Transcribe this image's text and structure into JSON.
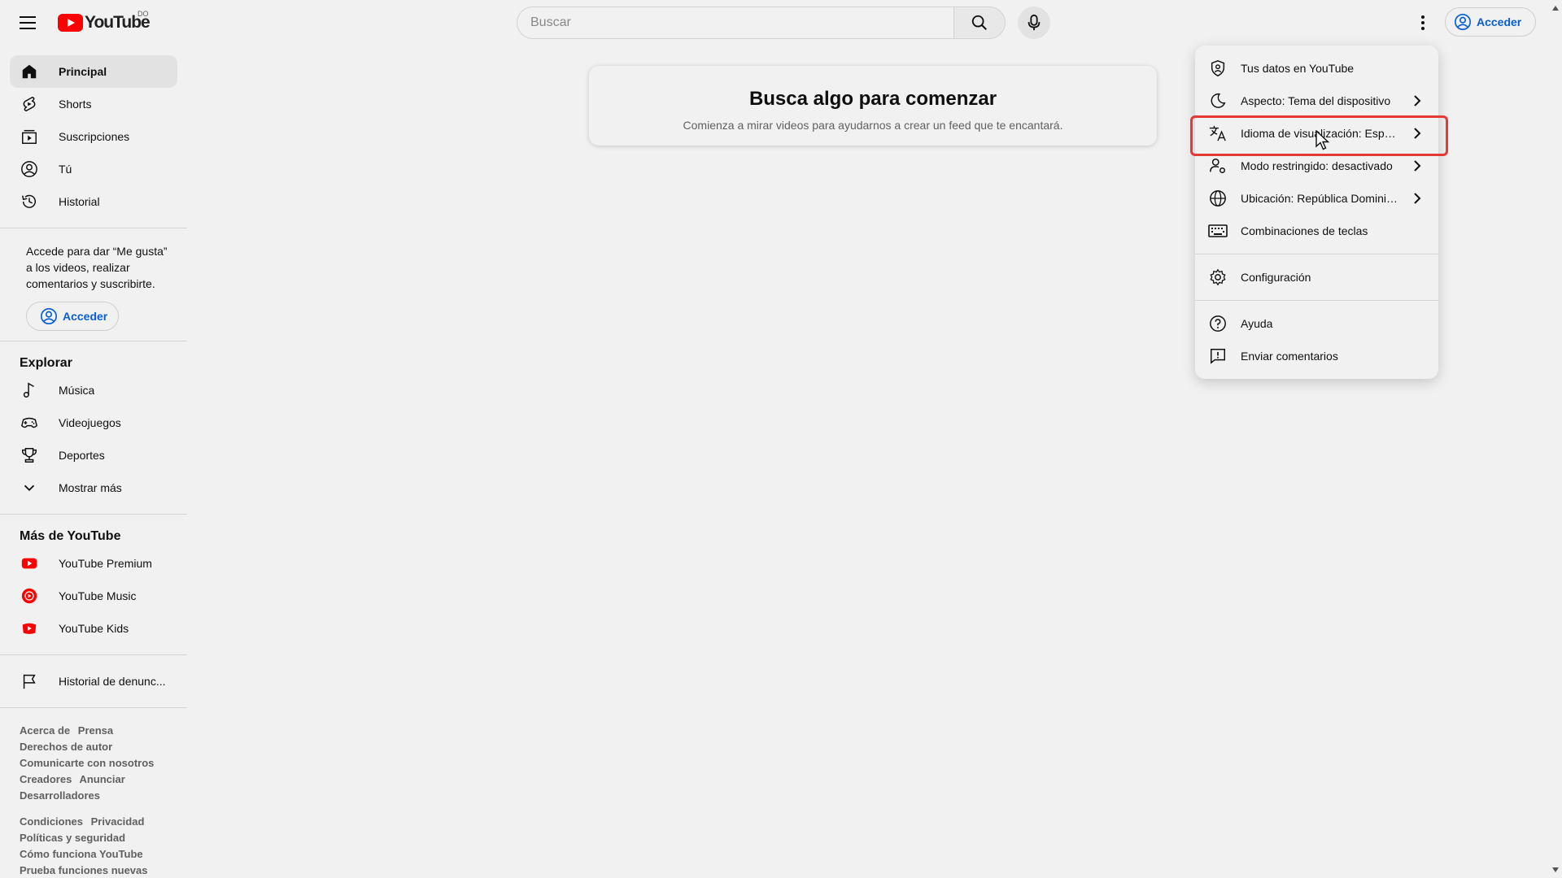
{
  "header": {
    "logo_text": "YouTube",
    "country_code": "DO",
    "search_placeholder": "Buscar",
    "signin_label": "Acceder"
  },
  "sidebar": {
    "main_items": [
      {
        "label": "Principal",
        "icon": "home-icon",
        "active": true
      },
      {
        "label": "Shorts",
        "icon": "shorts-icon"
      },
      {
        "label": "Suscripciones",
        "icon": "subscriptions-icon"
      },
      {
        "label": "Tú",
        "icon": "you-icon"
      },
      {
        "label": "Historial",
        "icon": "history-icon"
      }
    ],
    "signin_note": "Accede para dar “Me gusta” a los videos, realizar comentarios y suscribirte.",
    "signin_label": "Acceder",
    "explore_title": "Explorar",
    "explore_items": [
      {
        "label": "Música",
        "icon": "music-icon"
      },
      {
        "label": "Videojuegos",
        "icon": "gaming-icon"
      },
      {
        "label": "Deportes",
        "icon": "trophy-icon"
      },
      {
        "label": "Mostrar más",
        "icon": "chevron-down-icon"
      }
    ],
    "more_title": "Más de YouTube",
    "more_items": [
      {
        "label": "YouTube Premium",
        "icon": "youtube-premium-icon"
      },
      {
        "label": "YouTube Music",
        "icon": "youtube-music-icon"
      },
      {
        "label": "YouTube Kids",
        "icon": "youtube-kids-icon"
      }
    ],
    "report_history": "Historial de denunc...",
    "footer": {
      "group1": [
        "Acerca de",
        "Prensa",
        "Derechos de autor",
        "Comunicarte con nosotros",
        "Creadores",
        "Anunciar",
        "Desarrolladores"
      ],
      "group2": [
        "Condiciones",
        "Privacidad",
        "Políticas y seguridad",
        "Cómo funciona YouTube",
        "Prueba funciones nuevas"
      ]
    }
  },
  "main": {
    "empty_title": "Busca algo para comenzar",
    "empty_subtitle": "Comienza a mirar videos para ayudarnos a crear un feed que te encantará."
  },
  "settings_menu": {
    "items": [
      {
        "label": "Tus datos en YouTube",
        "icon": "shield-person-icon"
      },
      {
        "label": "Aspecto: Tema del dispositivo",
        "icon": "moon-icon",
        "chevron": true
      },
      {
        "label": "Idioma de visualización: Español",
        "icon": "translate-icon",
        "chevron": true,
        "highlighted": true
      },
      {
        "label": "Modo restringido: desactivado",
        "icon": "restricted-icon",
        "chevron": true
      },
      {
        "label": "Ubicación: República Dominicana",
        "icon": "globe-icon",
        "chevron": true
      },
      {
        "label": "Combinaciones de teclas",
        "icon": "keyboard-icon"
      },
      {
        "label": "Configuración",
        "icon": "gear-icon"
      },
      {
        "label": "Ayuda",
        "icon": "help-icon"
      },
      {
        "label": "Enviar comentarios",
        "icon": "feedback-icon"
      }
    ]
  },
  "colors": {
    "brand_red": "#ff0000",
    "link_blue": "#065fd4",
    "highlight_red": "#e53935",
    "background": "#f1f1f1"
  }
}
